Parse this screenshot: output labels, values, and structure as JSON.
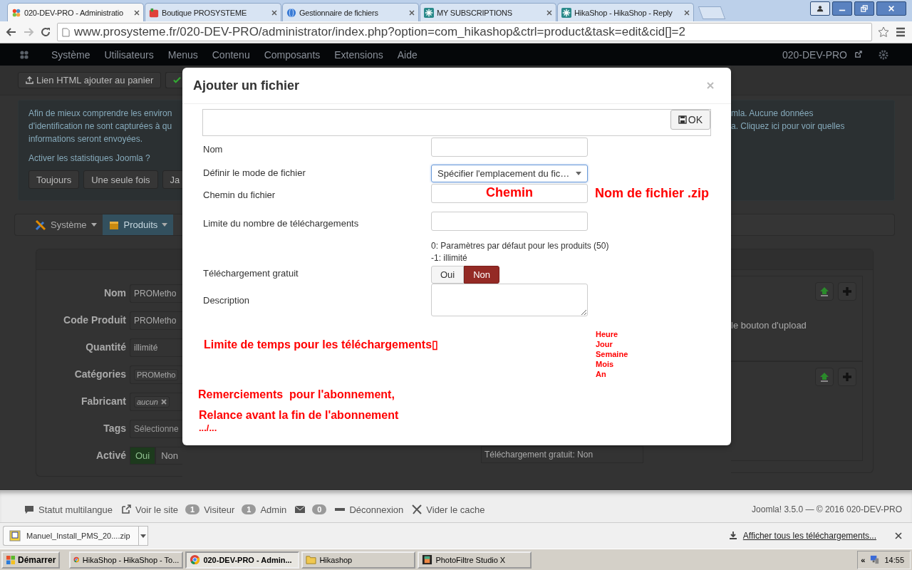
{
  "browser": {
    "tabs": [
      {
        "title": "020-DEV-PRO - Administratio",
        "selected": true,
        "kind": "joomla"
      },
      {
        "title": "Boutique PROSYSTEME",
        "selected": false,
        "kind": "shop"
      },
      {
        "title": "Gestionnaire de fichiers",
        "selected": false,
        "kind": "files"
      },
      {
        "title": "MY SUBSCRIPTIONS",
        "selected": false,
        "kind": "hika"
      },
      {
        "title": "HikaShop - HikaShop - Reply",
        "selected": false,
        "kind": "hika"
      }
    ],
    "url": "www.prosysteme.fr/020-DEV-PRO/administrator/index.php?option=com_hikashop&ctrl=product&task=edit&cid[]=2"
  },
  "admin_menu": {
    "items": [
      "Système",
      "Utilisateurs",
      "Menus",
      "Contenu",
      "Composants",
      "Extensions",
      "Aide"
    ],
    "site": "020-DEV-PRO"
  },
  "toolbar": {
    "buttons": [
      "Lien HTML ajouter au panier"
    ]
  },
  "stats_notice": {
    "left_lines": [
      "Afin de mieux comprendre les environ",
      "d'identification ne sont capturées à qu",
      "informations seront envoyées."
    ],
    "question": "Activer les statistiques Joomla ?",
    "buttons": [
      "Toujours",
      "Une seule fois",
      "Ja"
    ],
    "right_lines": [
      "mla. Aucune données",
      "a. Cliquez ici pour voir quelles"
    ]
  },
  "submenu": [
    {
      "label": "Système",
      "selected": false,
      "kind": "tools"
    },
    {
      "label": "Produits",
      "selected": true,
      "kind": "box"
    }
  ],
  "product_form": [
    {
      "label": "Nom",
      "kind": "text",
      "value": "PROMetho"
    },
    {
      "label": "Code Produit",
      "kind": "text",
      "value": "PROMetho"
    },
    {
      "label": "Quantité",
      "kind": "text",
      "value": "illimité"
    },
    {
      "label": "Catégories",
      "kind": "tag",
      "value": "PROMetho"
    },
    {
      "label": "Fabricant",
      "kind": "tag",
      "value": "aucun"
    },
    {
      "label": "Tags",
      "kind": "text",
      "placeholder": "Sélectionne"
    },
    {
      "label": "Activé",
      "kind": "toggle",
      "options": [
        {
          "label": "Oui",
          "selected": true
        },
        {
          "label": "Non",
          "selected": false
        }
      ]
    }
  ],
  "files_panel": {
    "upload_hint": "le bouton d'upload",
    "free_download": "Téléchargement gratuit: Non"
  },
  "modal": {
    "title": "Ajouter un fichier",
    "ok_button": "OK",
    "fields": [
      {
        "label": "Nom",
        "kind": "input"
      },
      {
        "label": "Définir le mode de fichier",
        "kind": "select",
        "value": "Spécifier l'emplacement du fic…"
      },
      {
        "label": "Chemin du fichier",
        "kind": "input",
        "value": "Chemin",
        "note": "Nom de fichier .zip"
      },
      {
        "label": "Limite du nombre de téléchargements",
        "kind": "input",
        "hints": [
          "0: Paramètres par défaut pour les produits (50)",
          "-1: illimité"
        ]
      },
      {
        "label": "Téléchargement gratuit",
        "kind": "toggle",
        "options": [
          {
            "label": "Oui",
            "selected": false
          },
          {
            "label": "Non",
            "selected": true
          }
        ]
      },
      {
        "label": "Description",
        "kind": "textarea"
      }
    ],
    "time_limit_note": "Limite de temps pour les téléchargements▯",
    "time_units": [
      "Heure",
      "Jour",
      "Semaine",
      "Mois",
      "An"
    ],
    "notes": [
      "Remerciements  pour l'abonnement,",
      "Relance avant la fin de l'abonnement",
      ".../..."
    ]
  },
  "status_bar": {
    "multilang": "Statut multilangue",
    "view_site": "Voir le site",
    "visitors_count": "1",
    "visitors": "Visiteur",
    "admins_count": "1",
    "admins": "Admin",
    "messages_count": "0",
    "logout": "Déconnexion",
    "clear_cache": "Vider le cache",
    "version": "Joomla! 3.5.0 — © 2016 020-DEV-PRO"
  },
  "downloads": {
    "file": "Manuel_Install_PMS_20....zip",
    "show_all": "Afficher tous les téléchargements..."
  },
  "taskbar": {
    "start": "Démarrer",
    "tasks": [
      {
        "label": "HikaShop - HikaShop - To...",
        "selected": false,
        "kind": "chrome"
      },
      {
        "label": "020-DEV-PRO - Admin...",
        "selected": true,
        "kind": "chrome"
      },
      {
        "label": "Hikashop",
        "selected": false,
        "kind": "folder"
      },
      {
        "label": "PhotoFiltre Studio X",
        "selected": false,
        "kind": "film"
      }
    ],
    "clock": "14:55",
    "tray_toggle": "«"
  }
}
